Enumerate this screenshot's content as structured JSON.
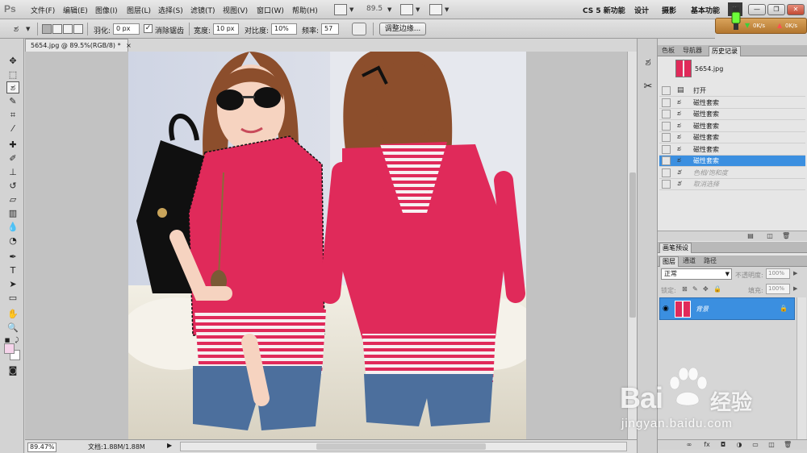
{
  "app": {
    "logo": "Ps"
  },
  "menu": [
    "文件(F)",
    "编辑(E)",
    "图像(I)",
    "图层(L)",
    "选择(S)",
    "滤镜(T)",
    "视图(V)",
    "窗口(W)",
    "帮助(H)"
  ],
  "menubar": {
    "zoom": "89.5"
  },
  "workspaces": [
    "CS 5 新功能",
    "设计",
    "摄影",
    "基本功能"
  ],
  "workspace_more": "»",
  "net": {
    "down": "0K/s",
    "up": "0K/s"
  },
  "options": {
    "feather_label": "羽化:",
    "feather_value": "0 px",
    "antialias_label": "消除锯齿",
    "width_label": "宽度:",
    "width_value": "10 px",
    "contrast_label": "对比度:",
    "contrast_value": "10%",
    "frequency_label": "频率:",
    "frequency_value": "57",
    "refine_button": "调整边缘..."
  },
  "document": {
    "tab_title": "5654.jpg @ 89.5%(RGB/8) *",
    "close": "×"
  },
  "status": {
    "zoom": "89.47%",
    "doc_info": "文档:1.88M/1.88M",
    "arrow": "▶"
  },
  "panels": {
    "top_tabs": [
      "色板",
      "导航器",
      "历史记录"
    ],
    "history": {
      "snapshot": "5654.jpg",
      "items": [
        {
          "label": "打开",
          "state": "normal"
        },
        {
          "label": "磁性套索",
          "state": "normal"
        },
        {
          "label": "磁性套索",
          "state": "normal"
        },
        {
          "label": "磁性套索",
          "state": "normal"
        },
        {
          "label": "磁性套索",
          "state": "normal"
        },
        {
          "label": "磁性套索",
          "state": "normal"
        },
        {
          "label": "磁性套索",
          "state": "selected"
        },
        {
          "label": "色相/饱和度",
          "state": "disabled"
        },
        {
          "label": "取消选择",
          "state": "disabled"
        }
      ]
    },
    "brush_tab": "画笔预设",
    "layer_tabs": [
      "图层",
      "通道",
      "路径"
    ],
    "layers": {
      "blend_mode": "正常",
      "opacity_label": "不透明度:",
      "opacity_value": "100%",
      "lock_label": "锁定:",
      "fill_label": "填充:",
      "fill_value": "100%",
      "layer_name": "背景"
    }
  },
  "watermark": {
    "brand": "Bai",
    "product": "经验",
    "url": "jingyan.baidu.com"
  },
  "colors": {
    "selection_blue": "#3b8fe0",
    "foreground": "#f5d3ea",
    "background": "#ffffff",
    "shirt": "#e02a5a"
  }
}
